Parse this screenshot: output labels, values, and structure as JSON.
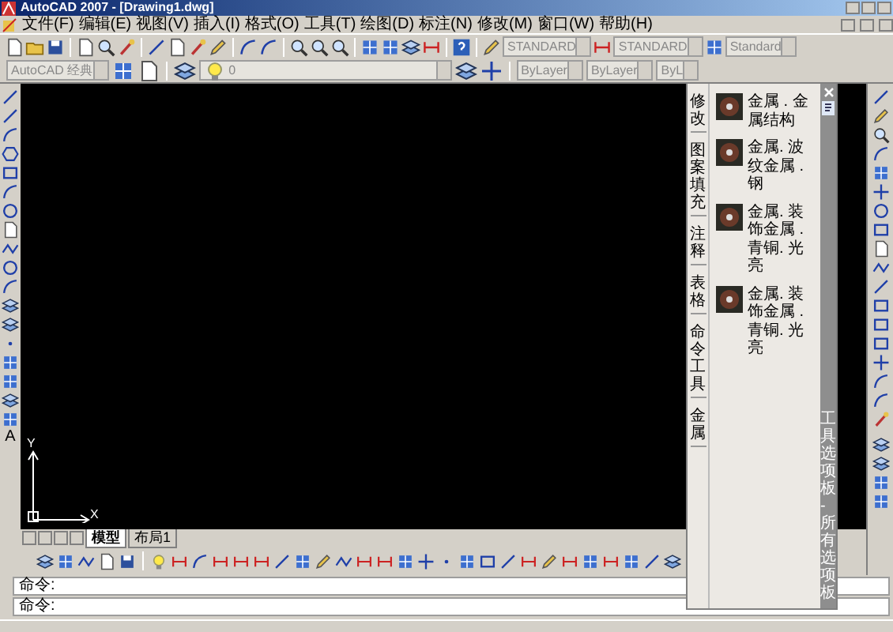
{
  "window": {
    "title": "AutoCAD 2007 - [Drawing1.dwg]"
  },
  "menu": [
    "文件(F)",
    "编辑(E)",
    "视图(V)",
    "插入(I)",
    "格式(O)",
    "工具(T)",
    "绘图(D)",
    "标注(N)",
    "修改(M)",
    "窗口(W)",
    "帮助(H)"
  ],
  "styles": {
    "text_style": "STANDARD",
    "dim_style": "STANDARD",
    "table_style": "Standard"
  },
  "properties": {
    "workspace": "AutoCAD 经典",
    "layer": "0",
    "color_mode": "ByLayer",
    "linetype": "ByLayer",
    "lineweight": "ByL"
  },
  "left_toolbar": {
    "text_glyph": "A"
  },
  "ucs": {
    "y": "Y",
    "x": "X"
  },
  "layout_tabs": [
    {
      "label": "模型",
      "selected": true
    },
    {
      "label": "布局1",
      "selected": false
    }
  ],
  "palette": {
    "title": "工具选项板 - 所有选项板",
    "tabs": [
      "修改",
      "图案填充",
      "注释",
      "表格",
      "命令工具",
      "金属"
    ],
    "items": [
      {
        "label": "金属 . 金属结构"
      },
      {
        "label": "金属. 波纹金属 . 钢"
      },
      {
        "label": "金属. 装饰金属 . 青铜. 光亮"
      },
      {
        "label": "金属. 装饰金属 . 青铜. 光亮"
      }
    ]
  },
  "command_lines": [
    "命令:",
    "命令:"
  ]
}
